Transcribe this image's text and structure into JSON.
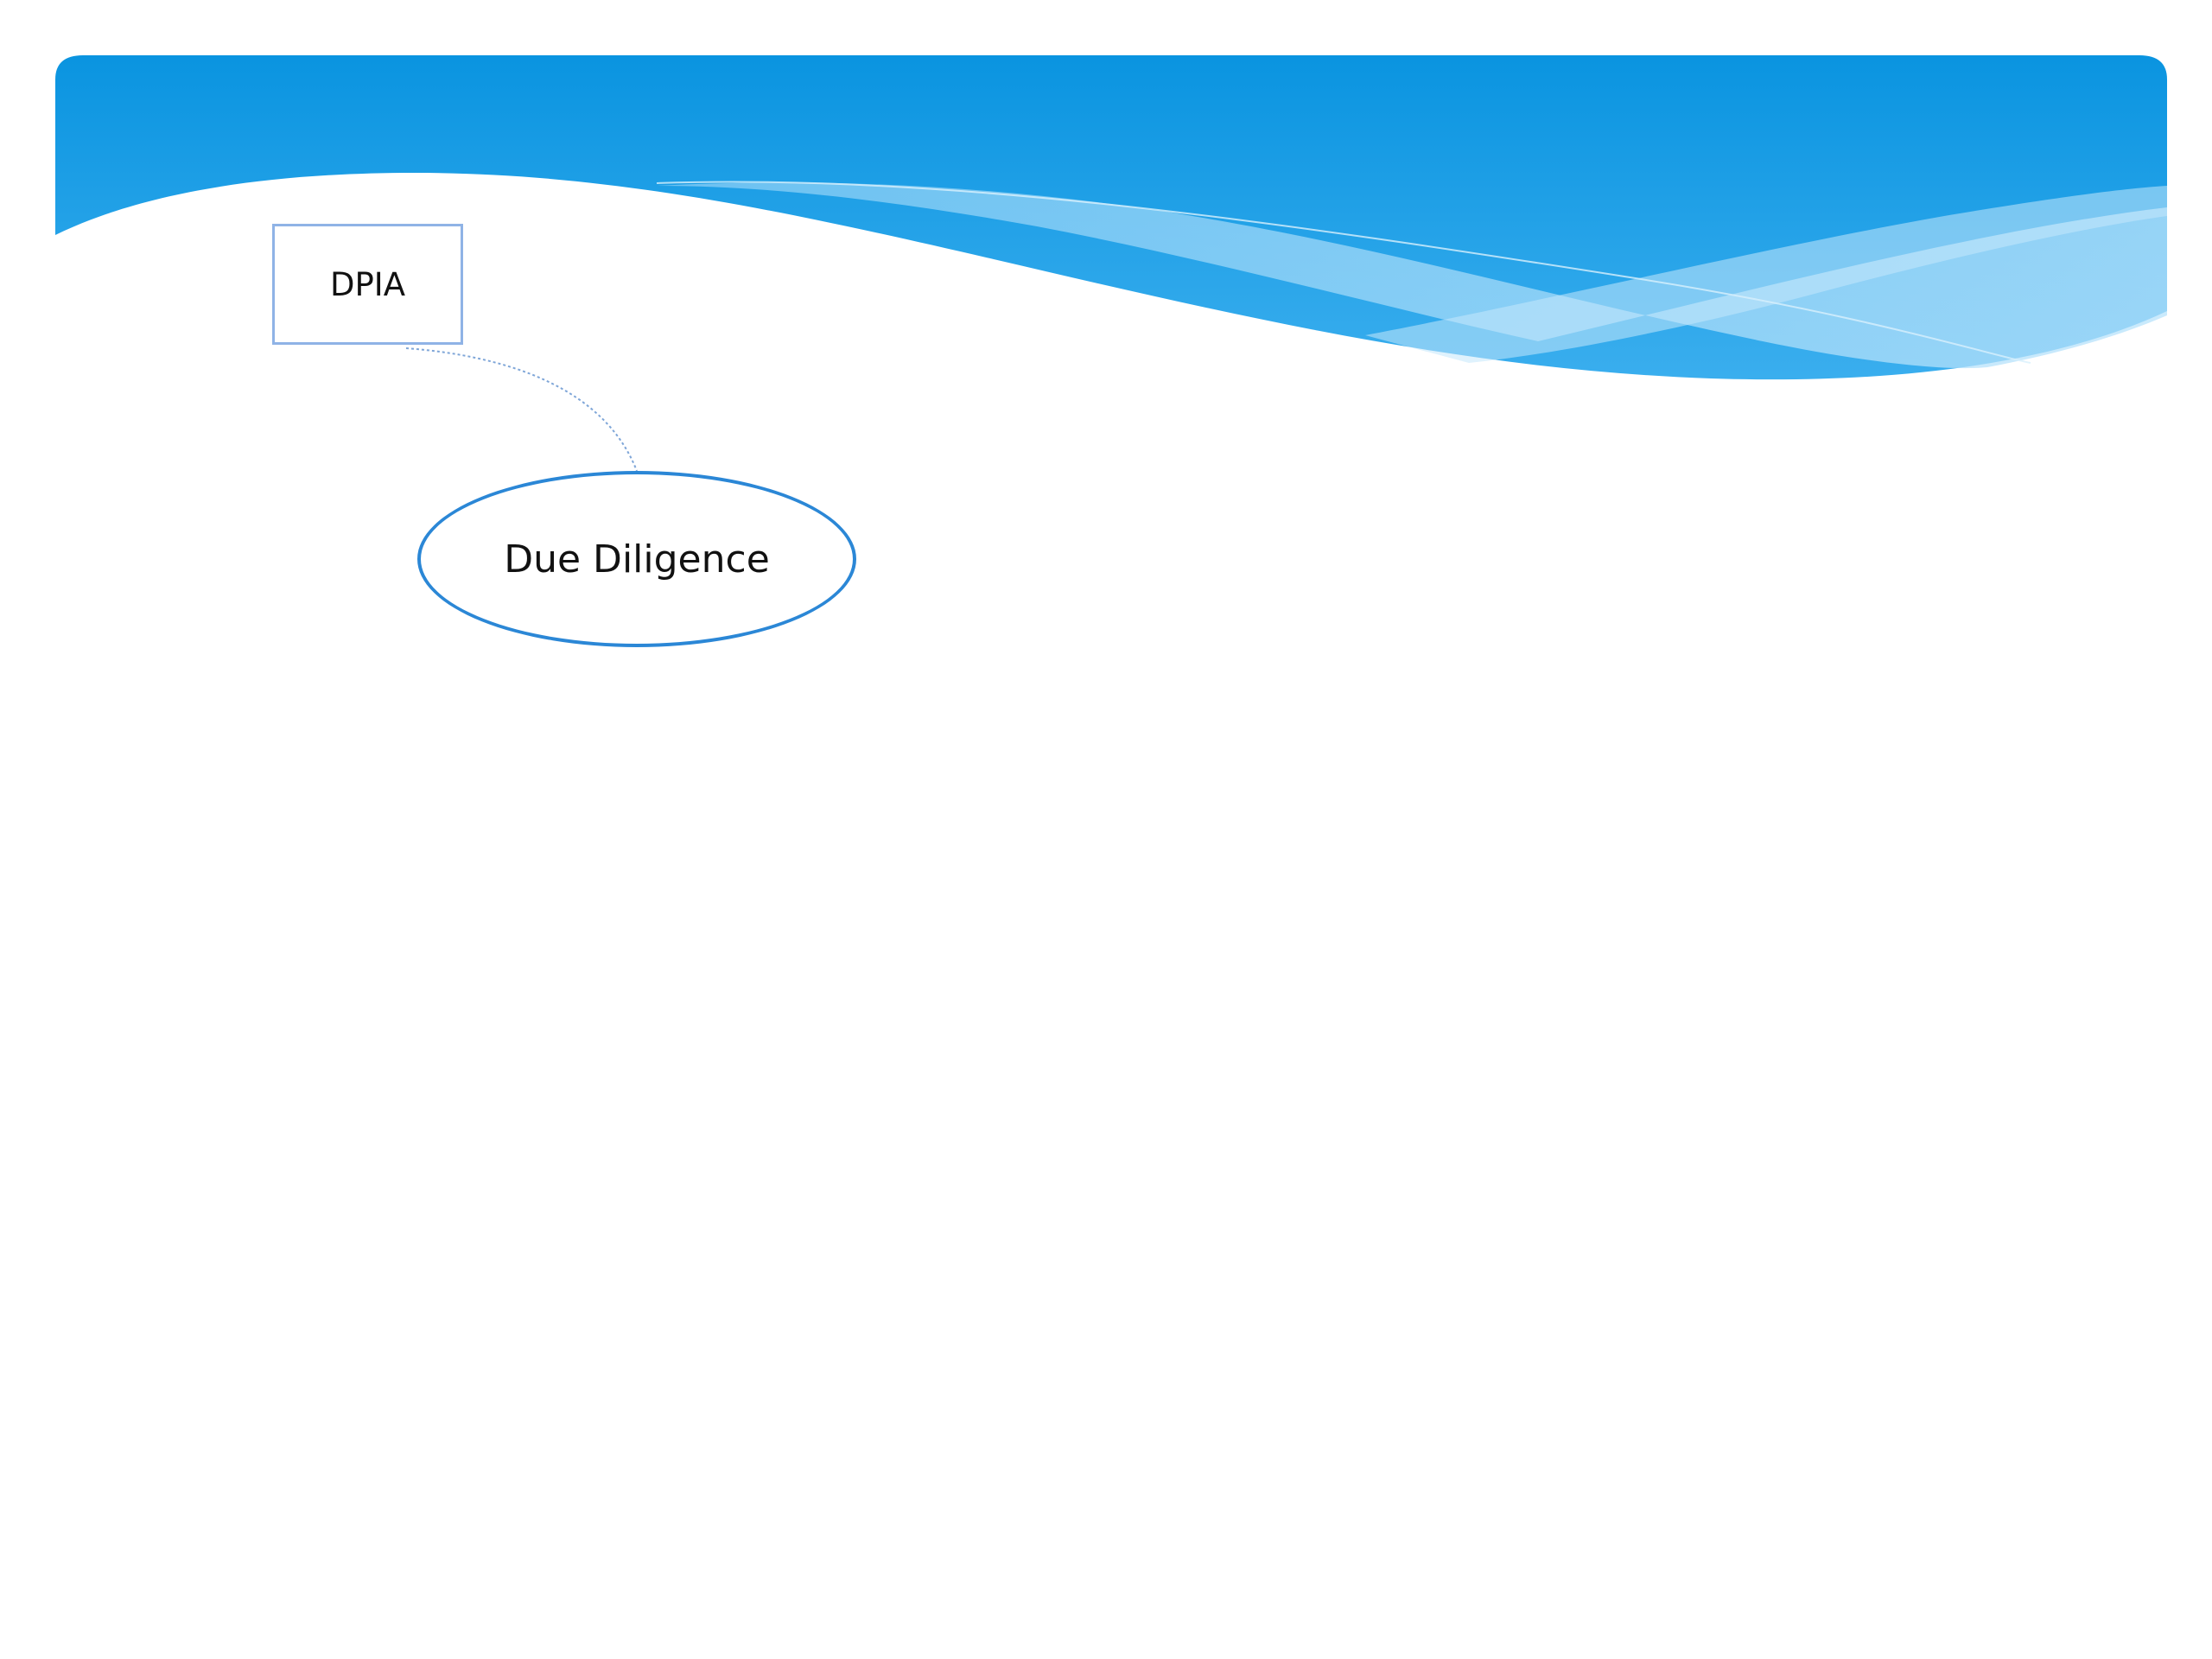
{
  "colors": {
    "header_top": "#0a94e0",
    "header_mid": "#2ea7ea",
    "wave_light": "#8ed0f6",
    "box_border": "#8fb3e6",
    "ellipse_border": "#2b87d6",
    "connector": "#7fa6d8"
  },
  "diagram": {
    "nodes": [
      {
        "id": "dpia",
        "shape": "rectangle",
        "label": "DPIA"
      },
      {
        "id": "due-diligence",
        "shape": "ellipse",
        "label": "Due Diligence"
      }
    ],
    "edges": [
      {
        "from": "dpia",
        "to": "due-diligence",
        "style": "dotted"
      }
    ]
  }
}
